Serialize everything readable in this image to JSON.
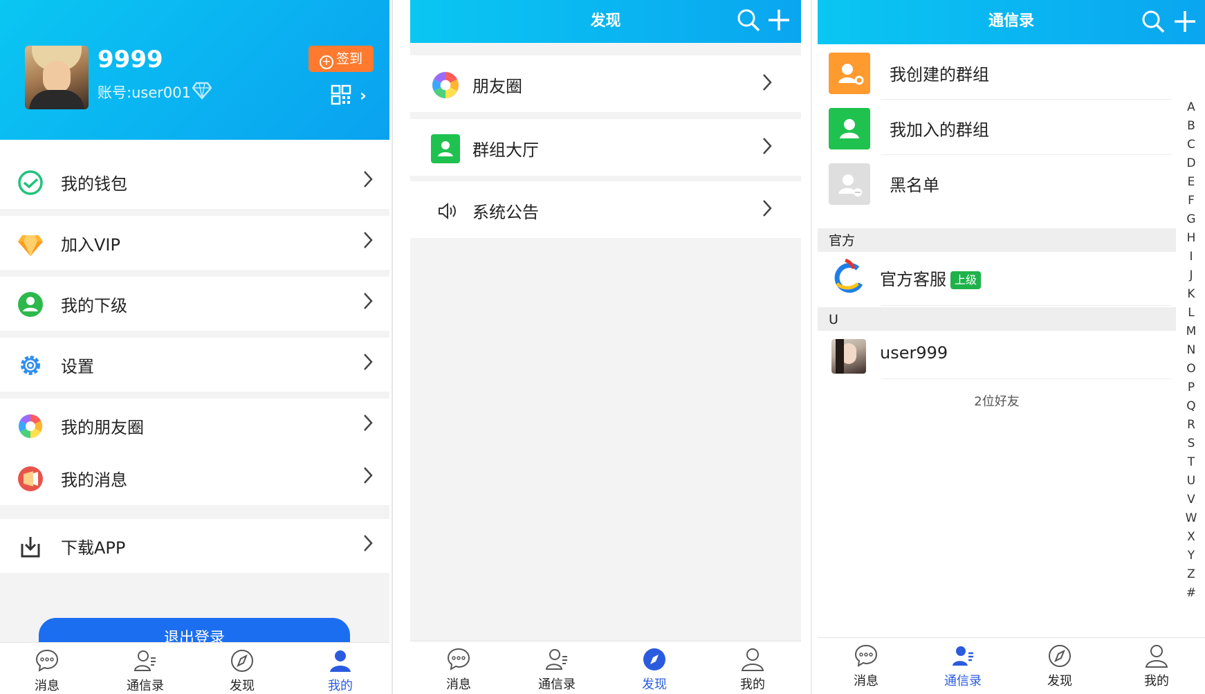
{
  "profile": {
    "name": "9999",
    "account": "账号:user001",
    "checkin_label": "签到"
  },
  "mine_menu": [
    {
      "label": "我的钱包",
      "icon": "wallet-icon"
    },
    {
      "label": "加入VIP",
      "icon": "vip-diamond-icon"
    },
    {
      "label": "我的下级",
      "icon": "subordinate-icon"
    },
    {
      "label": "设置",
      "icon": "gear-icon"
    },
    {
      "label": "我的朋友圈",
      "icon": "moments-icon"
    },
    {
      "label": "我的消息",
      "icon": "message-icon"
    },
    {
      "label": "下载APP",
      "icon": "download-icon"
    }
  ],
  "logout_label": "退出登录",
  "tabs": [
    {
      "label": "消息",
      "icon": "chat-icon"
    },
    {
      "label": "通信录",
      "icon": "contacts-icon"
    },
    {
      "label": "发现",
      "icon": "compass-icon"
    },
    {
      "label": "我的",
      "icon": "person-icon"
    }
  ],
  "discover": {
    "title": "发现",
    "items": [
      {
        "label": "朋友圈",
        "icon": "moments-icon"
      },
      {
        "label": "群组大厅",
        "icon": "group-hall-icon"
      },
      {
        "label": "系统公告",
        "icon": "speaker-icon"
      }
    ]
  },
  "contacts": {
    "title": "通信录",
    "groups": [
      {
        "label": "我创建的群组",
        "icon": "created-group-icon",
        "color": "#ff9a2e"
      },
      {
        "label": "我加入的群组",
        "icon": "joined-group-icon",
        "color": "#1fc24f"
      },
      {
        "label": "黑名单",
        "icon": "blacklist-icon",
        "color": "#d9d9d9"
      }
    ],
    "section_official": "官方",
    "official_contact": "官方客服",
    "official_badge": "上级",
    "section_u": "U",
    "user_contact": "user999",
    "friend_count": "2位好友",
    "index_letters": [
      "A",
      "B",
      "C",
      "D",
      "E",
      "F",
      "G",
      "H",
      "I",
      "J",
      "K",
      "L",
      "M",
      "N",
      "O",
      "P",
      "Q",
      "R",
      "S",
      "T",
      "U",
      "V",
      "W",
      "X",
      "Y",
      "Z",
      "#"
    ]
  },
  "colors": {
    "header_blue": "#0ab4f1",
    "active_tab": "#2a5bdf",
    "checkin_orange": "#ff7a2e",
    "logout_blue": "#1c6ef0"
  }
}
